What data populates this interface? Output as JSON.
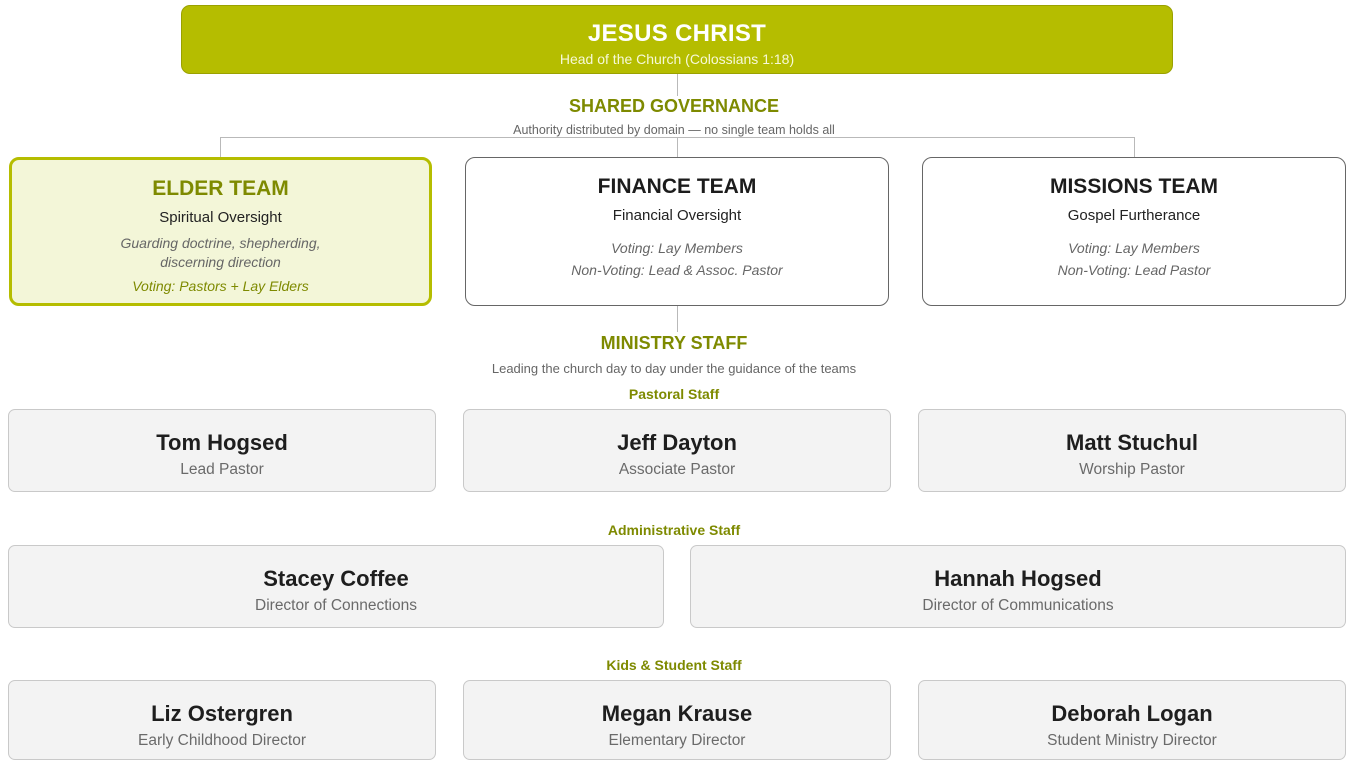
{
  "head": {
    "title": "JESUS CHRIST",
    "subtitle": "Head of the Church  (Colossians 1:18)"
  },
  "governance": {
    "title": "SHARED GOVERNANCE",
    "subtitle": "Authority distributed by domain — no single team holds all"
  },
  "teams": [
    {
      "title": "ELDER TEAM",
      "subtitle": "Spiritual Oversight",
      "description": [
        "Guarding doctrine, shepherding,",
        "discerning direction"
      ],
      "voting": [
        "Voting: Pastors + Lay Elders"
      ]
    },
    {
      "title": "FINANCE TEAM",
      "subtitle": "Financial Oversight",
      "description": [],
      "voting": [
        "Voting: Lay Members",
        "Non-Voting: Lead & Assoc. Pastor"
      ]
    },
    {
      "title": "MISSIONS TEAM",
      "subtitle": "Gospel Furtherance",
      "description": [],
      "voting": [
        "Voting: Lay Members",
        "Non-Voting: Lead Pastor"
      ]
    }
  ],
  "ministry": {
    "title": "MINISTRY STAFF",
    "subtitle": "Leading the church day to day under the guidance of the teams"
  },
  "groups": [
    {
      "label": "Pastoral Staff",
      "people": [
        {
          "name": "Tom Hogsed",
          "role": "Lead Pastor"
        },
        {
          "name": "Jeff Dayton",
          "role": "Associate Pastor"
        },
        {
          "name": "Matt Stuchul",
          "role": "Worship Pastor"
        }
      ]
    },
    {
      "label": "Administrative Staff",
      "people": [
        {
          "name": "Stacey Coffee",
          "role": "Director of Connections"
        },
        {
          "name": "Hannah Hogsed",
          "role": "Director of Communications"
        }
      ]
    },
    {
      "label": "Kids & Student Staff",
      "people": [
        {
          "name": "Liz Ostergren",
          "role": "Early Childhood Director"
        },
        {
          "name": "Megan Krause",
          "role": "Elementary Director"
        },
        {
          "name": "Deborah Logan",
          "role": "Student Ministry Director"
        }
      ]
    }
  ],
  "colors": {
    "accent": "#b5bd00",
    "accent_text": "#7e8a00",
    "elder_fill": "#f3f6d8",
    "staff_fill": "#f3f3f3",
    "connector": "#b9b9b9"
  }
}
